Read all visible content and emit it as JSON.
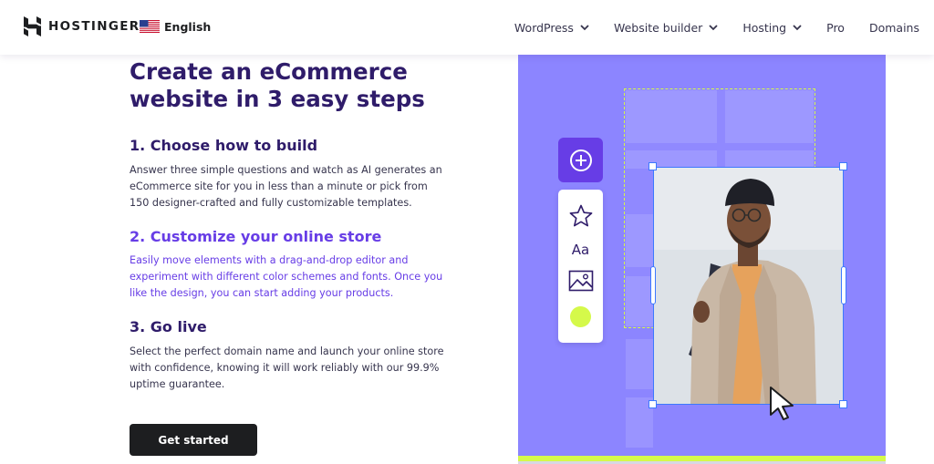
{
  "header": {
    "logo_text": "HOSTINGER",
    "language": "English",
    "nav": [
      {
        "label": "WordPress",
        "has_dropdown": true
      },
      {
        "label": "Website builder",
        "has_dropdown": true
      },
      {
        "label": "Hosting",
        "has_dropdown": true
      },
      {
        "label": "Pro",
        "has_dropdown": false
      },
      {
        "label": "Domains",
        "has_dropdown": false
      }
    ]
  },
  "hero": {
    "title": "Create an eCommerce website in 3 easy steps"
  },
  "steps": [
    {
      "title": "1. Choose how to build",
      "description": "Answer three simple questions and watch as AI generates an eCommerce site for you in less than a minute or pick from 150 designer-crafted and fully customizable templates.",
      "active": false
    },
    {
      "title": "2. Customize your online store",
      "description": "Easily move elements with a drag-and-drop editor and experiment with different color schemes and fonts. Once you like the design, you can start adding your products.",
      "active": true
    },
    {
      "title": "3. Go live",
      "description": "Select the perfect domain name and launch your online store with confidence, knowing it will work reliably with our 99.9% uptime guarantee.",
      "active": false
    }
  ],
  "cta": {
    "label": "Get started"
  },
  "illustration": {
    "toolbar_text_tool": "Aa",
    "icons": [
      "plus-circle-icon",
      "star-icon",
      "text-icon",
      "image-icon",
      "color-dot-icon",
      "pointer-cursor-icon"
    ]
  },
  "colors": {
    "primary": "#673de6",
    "dark_text": "#2f1c6a",
    "body_text": "#36344d",
    "panel": "#8c85ff",
    "accent_lime": "#d5f94a",
    "selection_blue": "#3d79ff",
    "button_bg": "#1d1e20"
  }
}
